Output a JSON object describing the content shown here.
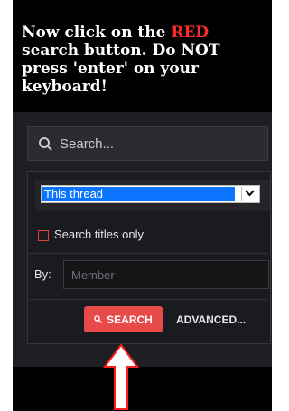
{
  "instruction": {
    "before": "Now click on the ",
    "highlight": "RED",
    "after": " search button.  Do NOT press 'enter' on your keyboard!"
  },
  "search": {
    "placeholder": "Search..."
  },
  "scope_select": {
    "selected": "This thread"
  },
  "options": {
    "titles_only_label": "Search titles only"
  },
  "by": {
    "label": "By:",
    "placeholder": "Member"
  },
  "actions": {
    "search_label": "SEARCH",
    "advanced_label": "ADVANCED..."
  },
  "icons": {
    "search": "search-icon",
    "chevron": "chevron-down-icon",
    "arrow": "up-arrow-icon"
  },
  "colors": {
    "accent_red": "#e84a4a",
    "instruction_red": "#ff2a2a",
    "select_highlight": "#0a74ff"
  }
}
